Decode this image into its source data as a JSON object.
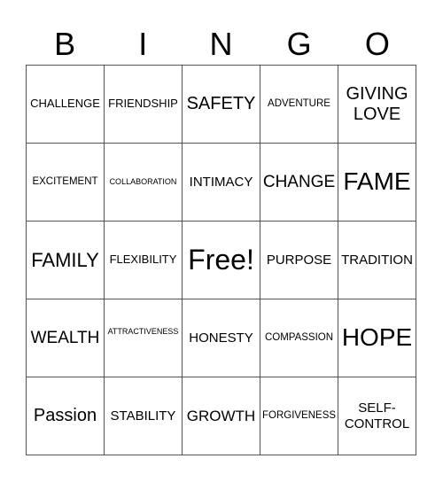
{
  "header": {
    "letters": [
      "B",
      "I",
      "N",
      "G",
      "O"
    ]
  },
  "grid": {
    "rows": [
      [
        "CHALLENGE",
        "FRIENDSHIP",
        "SAFETY",
        "ADVENTURE",
        "GIVING LOVE"
      ],
      [
        "EXCITEMENT",
        "COLLABORATION",
        "INTIMACY",
        "CHANGE",
        "FAME"
      ],
      [
        "FAMILY",
        "FLEXIBILITY",
        "Free!",
        "PURPOSE",
        "TRADITION"
      ],
      [
        "WEALTH",
        "ATTRACTIVENESS",
        "HONESTY",
        "COMPASSION",
        "HOPE"
      ],
      [
        "Passion",
        "STABILITY",
        "GROWTH",
        "FORGIVENESS",
        "SELF-CONTROL"
      ]
    ]
  }
}
